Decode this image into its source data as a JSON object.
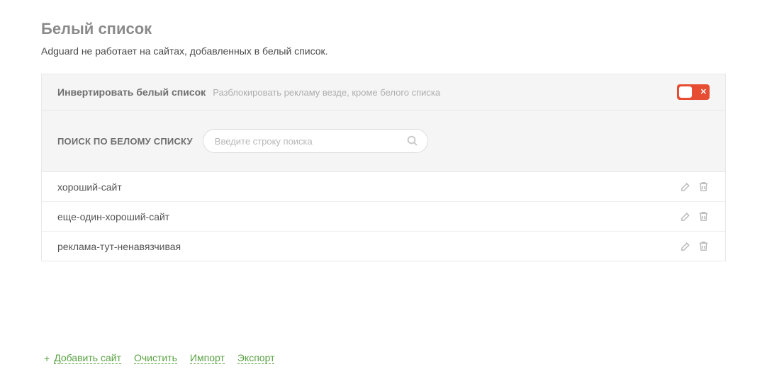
{
  "header": {
    "title": "Белый список",
    "subtitle": "Adguard не работает на сайтах, добавленных в белый список."
  },
  "invert": {
    "label": "Инвертировать белый список",
    "hint": "Разблокировать рекламу везде, кроме белого списка",
    "enabled": false
  },
  "search": {
    "label": "ПОИСК ПО БЕЛОМУ СПИСКУ",
    "placeholder": "Введите строку поиска",
    "value": ""
  },
  "list": {
    "items": [
      "хороший-сайт",
      "еще-один-хороший-сайт",
      "реклама-тут-ненавязчивая"
    ]
  },
  "footer": {
    "add": "Добавить сайт",
    "clear": "Очистить",
    "import": "Импорт",
    "export": "Экспорт"
  }
}
